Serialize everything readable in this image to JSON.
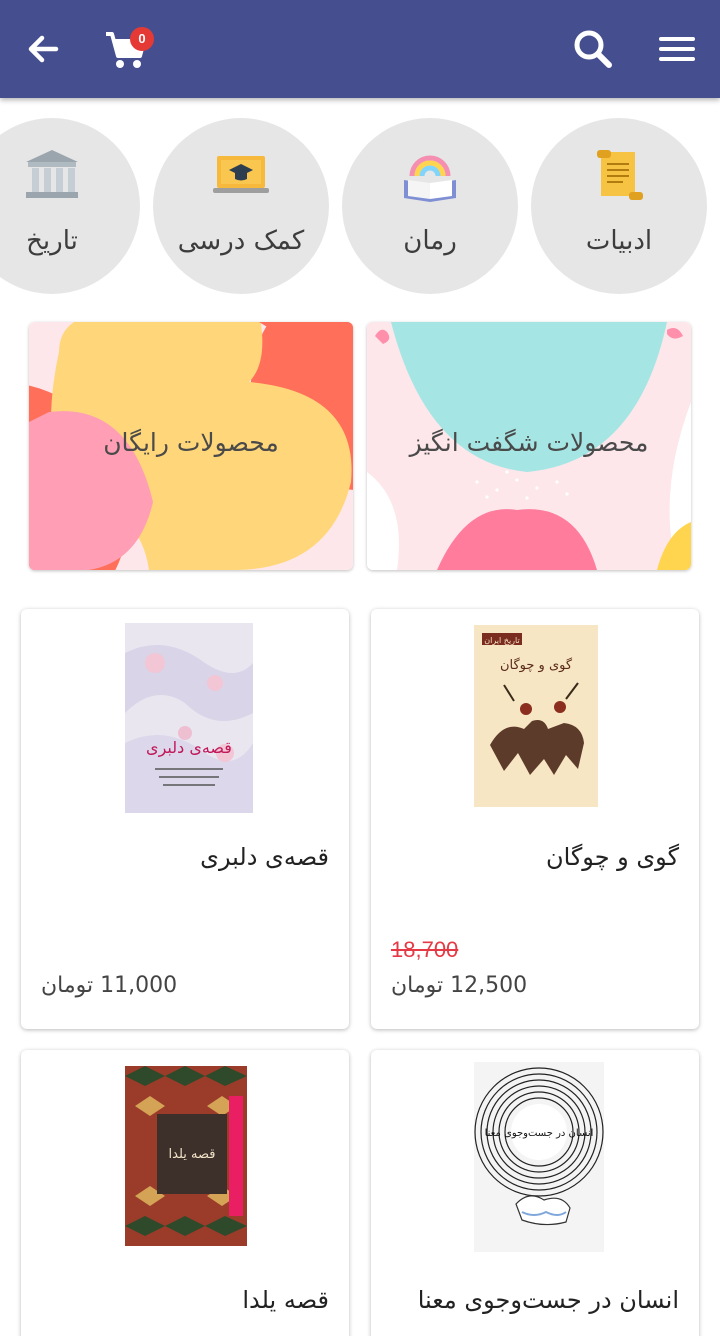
{
  "appbar": {
    "cart_count": "0",
    "colors": {
      "bar": "#454f8f",
      "badge": "#e53935"
    }
  },
  "categories": [
    {
      "label": "ادبیات",
      "icon": "scroll-icon"
    },
    {
      "label": "رمان",
      "icon": "rainbow-book-icon"
    },
    {
      "label": "کمک درسی",
      "icon": "laptop-graduation-icon"
    },
    {
      "label": "تاریخ",
      "icon": "museum-icon"
    }
  ],
  "banners": [
    {
      "label": "محصولات شگفت انگیز"
    },
    {
      "label": "محصولات رایگان"
    }
  ],
  "products": [
    {
      "title": "گوی و چوگان",
      "old_price": "18,700",
      "price": "12,500 تومان"
    },
    {
      "title": "قصه‌ی دلبری",
      "old_price": "",
      "price": "11,000 تومان"
    },
    {
      "title": "انسان در جست‌وجوی معنا",
      "old_price": "",
      "price": ""
    },
    {
      "title": "قصه یلدا",
      "old_price": "",
      "price": ""
    }
  ],
  "book_covers": {
    "polo": {
      "series": "تاریخ ایران",
      "title": "گوی و چوگان"
    },
    "delbari": {
      "title": "قصه‌ی دلبری"
    },
    "meaning": {
      "title": "انسان در جست‌وجوی معنا"
    },
    "yalda": {
      "title": "قصه یلدا"
    }
  }
}
